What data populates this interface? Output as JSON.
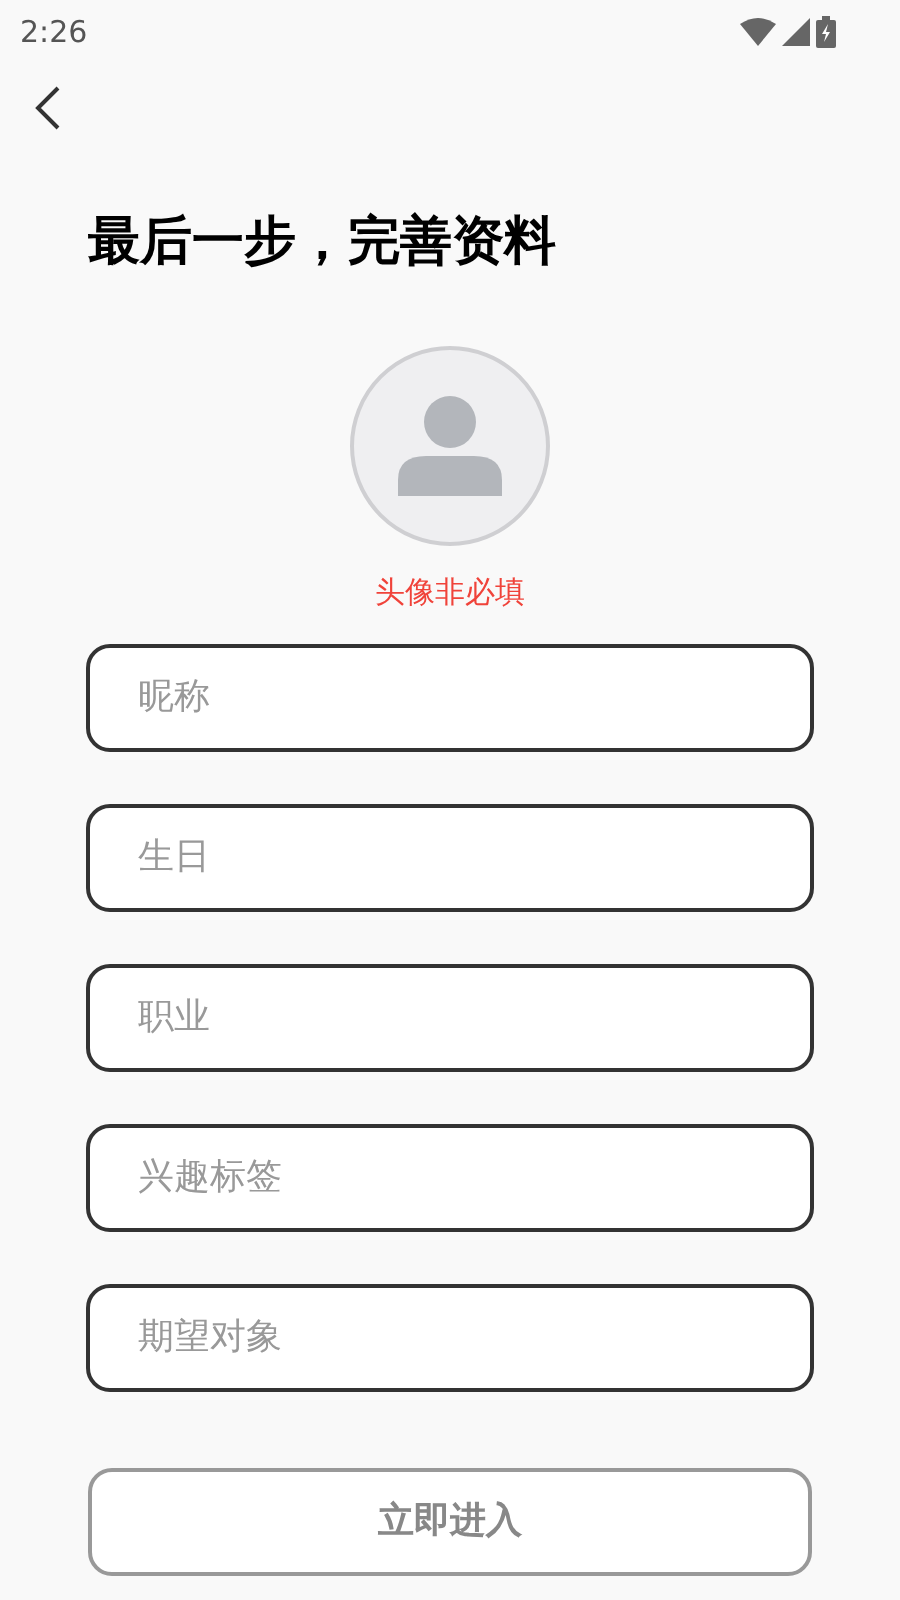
{
  "status_bar": {
    "time": "2:26"
  },
  "title": "最后一步，完善资料",
  "avatar_hint": "头像非必填",
  "fields": [
    {
      "placeholder": "昵称"
    },
    {
      "placeholder": "生日"
    },
    {
      "placeholder": "职业"
    },
    {
      "placeholder": "兴趣标签"
    },
    {
      "placeholder": "期望对象"
    }
  ],
  "submit": {
    "label": "立即进入",
    "disabled": true
  }
}
